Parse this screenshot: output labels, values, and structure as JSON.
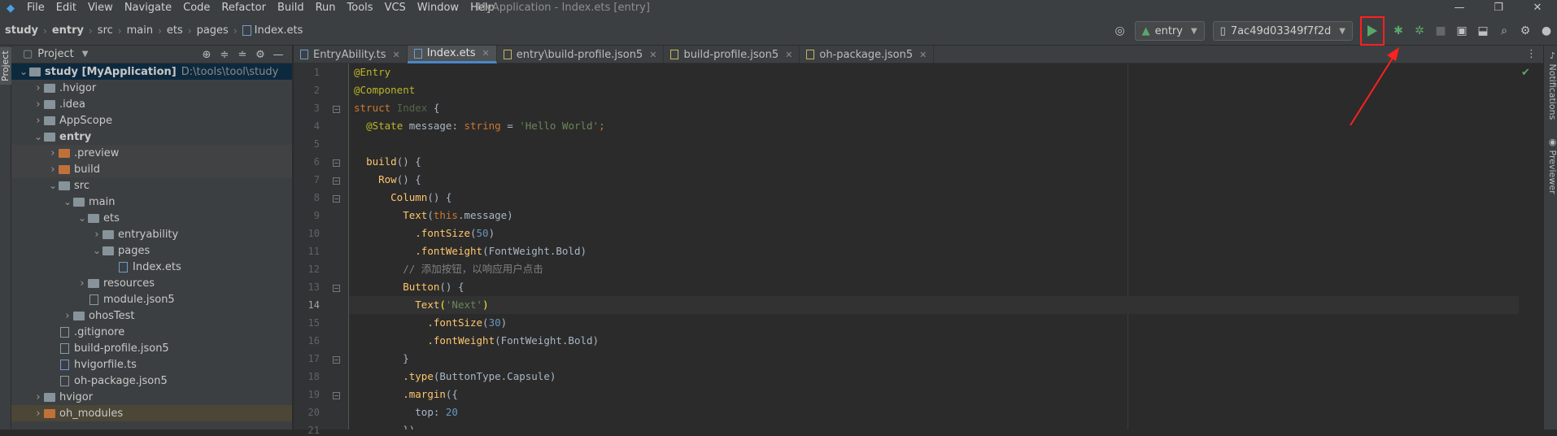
{
  "menubar": {
    "items": [
      "File",
      "Edit",
      "View",
      "Navigate",
      "Code",
      "Refactor",
      "Build",
      "Run",
      "Tools",
      "VCS",
      "Window",
      "Help"
    ],
    "title": "MyApplication - Index.ets [entry]",
    "controls": [
      "—",
      "❐",
      "✕"
    ]
  },
  "breadcrumb": {
    "items": [
      "study",
      "entry",
      "src",
      "main",
      "ets",
      "pages",
      "Index.ets"
    ]
  },
  "toolbar": {
    "module": "entry",
    "device": "7ac49d03349f7f2d"
  },
  "project": {
    "title": "Project",
    "tree": [
      {
        "name": "study [MyApplication]",
        "path": "D:\\tools\\tool\\study",
        "indent": 0,
        "open": true,
        "type": "folder",
        "bold": true
      },
      {
        "name": ".hvigor",
        "indent": 1,
        "type": "folder"
      },
      {
        "name": ".idea",
        "indent": 1,
        "type": "folder"
      },
      {
        "name": "AppScope",
        "indent": 1,
        "type": "folder"
      },
      {
        "name": "entry",
        "indent": 1,
        "open": true,
        "type": "folder",
        "bold": true
      },
      {
        "name": ".preview",
        "indent": 2,
        "type": "folder-orange"
      },
      {
        "name": "build",
        "indent": 2,
        "type": "folder-orange"
      },
      {
        "name": "src",
        "indent": 2,
        "open": true,
        "type": "folder"
      },
      {
        "name": "main",
        "indent": 3,
        "open": true,
        "type": "folder"
      },
      {
        "name": "ets",
        "indent": 4,
        "open": true,
        "type": "folder"
      },
      {
        "name": "entryability",
        "indent": 5,
        "type": "folder"
      },
      {
        "name": "pages",
        "indent": 5,
        "open": true,
        "type": "folder"
      },
      {
        "name": "Index.ets",
        "indent": 6,
        "type": "file-ts",
        "leaf": true
      },
      {
        "name": "resources",
        "indent": 4,
        "type": "folder"
      },
      {
        "name": "module.json5",
        "indent": 4,
        "type": "file",
        "leaf": true
      },
      {
        "name": "ohosTest",
        "indent": 3,
        "type": "folder"
      },
      {
        "name": ".gitignore",
        "indent": 2,
        "type": "file",
        "leaf": true
      },
      {
        "name": "build-profile.json5",
        "indent": 2,
        "type": "file",
        "leaf": true
      },
      {
        "name": "hvigorfile.ts",
        "indent": 2,
        "type": "file-ts",
        "leaf": true
      },
      {
        "name": "oh-package.json5",
        "indent": 2,
        "type": "file",
        "leaf": true
      },
      {
        "name": "hvigor",
        "indent": 1,
        "type": "folder"
      },
      {
        "name": "oh_modules",
        "indent": 1,
        "type": "folder-orange",
        "highlight": true
      }
    ]
  },
  "tabs": [
    {
      "label": "EntryAbility.ts",
      "active": false
    },
    {
      "label": "Index.ets",
      "active": true
    },
    {
      "label": "entry\\build-profile.json5",
      "active": false
    },
    {
      "label": "build-profile.json5",
      "active": false
    },
    {
      "label": "oh-package.json5",
      "active": false
    }
  ],
  "code": [
    [
      [
        "@Entry",
        "#bbb529"
      ]
    ],
    [
      [
        "@Component",
        "#bbb529"
      ]
    ],
    [
      [
        "struct ",
        "#cc7832"
      ],
      [
        "Index ",
        "#6a8759a0"
      ],
      [
        "{",
        "#a9b7c6"
      ]
    ],
    [
      [
        "  ",
        ""
      ],
      [
        "@State ",
        "#bbb529"
      ],
      [
        "message",
        "#a9b7c6"
      ],
      [
        ": ",
        "#a9b7c6"
      ],
      [
        "string ",
        "#cc7832"
      ],
      [
        "= ",
        "#a9b7c6"
      ],
      [
        "'Hello World'",
        "#6a8759"
      ],
      [
        ";",
        "#cc7832"
      ]
    ],
    [],
    [
      [
        "  ",
        ""
      ],
      [
        "build",
        "#ffc66d"
      ],
      [
        "() {",
        "#a9b7c6"
      ]
    ],
    [
      [
        "    ",
        ""
      ],
      [
        "Row",
        "#ffc66d"
      ],
      [
        "() {",
        "#a9b7c6"
      ]
    ],
    [
      [
        "      ",
        ""
      ],
      [
        "Column",
        "#ffc66d"
      ],
      [
        "() {",
        "#a9b7c6"
      ]
    ],
    [
      [
        "        ",
        ""
      ],
      [
        "Text",
        "#ffc66d"
      ],
      [
        "(",
        "#a9b7c6"
      ],
      [
        "this",
        "#cc7832"
      ],
      [
        ".message)",
        "#a9b7c6"
      ]
    ],
    [
      [
        "          ",
        ""
      ],
      [
        ".fontSize",
        "#ffc66d"
      ],
      [
        "(",
        "#a9b7c6"
      ],
      [
        "50",
        "#6897bb"
      ],
      [
        ")",
        "#a9b7c6"
      ]
    ],
    [
      [
        "          ",
        ""
      ],
      [
        ".fontWeight",
        "#ffc66d"
      ],
      [
        "(FontWeight.Bold)",
        "#a9b7c6"
      ]
    ],
    [
      [
        "        ",
        ""
      ],
      [
        "// 添加按钮，以响应用户点击",
        "#808080"
      ]
    ],
    [
      [
        "        ",
        ""
      ],
      [
        "Button",
        "#ffc66d"
      ],
      [
        "() {",
        "#a9b7c6"
      ]
    ],
    [
      [
        "          ",
        ""
      ],
      [
        "Text",
        "#ffc66d"
      ],
      [
        "(",
        "#ffef28"
      ],
      [
        "'Next'",
        "#6a8759"
      ],
      [
        ")",
        "#ffef28"
      ]
    ],
    [
      [
        "            ",
        ""
      ],
      [
        ".fontSize",
        "#ffc66d"
      ],
      [
        "(",
        "#a9b7c6"
      ],
      [
        "30",
        "#6897bb"
      ],
      [
        ")",
        "#a9b7c6"
      ]
    ],
    [
      [
        "            ",
        ""
      ],
      [
        ".fontWeight",
        "#ffc66d"
      ],
      [
        "(FontWeight.Bold)",
        "#a9b7c6"
      ]
    ],
    [
      [
        "        ",
        ""
      ],
      [
        "}",
        "#a9b7c6"
      ]
    ],
    [
      [
        "        ",
        ""
      ],
      [
        ".type",
        "#ffc66d"
      ],
      [
        "(ButtonType.Capsule)",
        "#a9b7c6"
      ]
    ],
    [
      [
        "        ",
        ""
      ],
      [
        ".margin",
        "#ffc66d"
      ],
      [
        "({",
        "#a9b7c6"
      ]
    ],
    [
      [
        "          ",
        ""
      ],
      [
        "top",
        "#a9b7c6"
      ],
      [
        ": ",
        "#a9b7c6"
      ],
      [
        "20",
        "#6897bb"
      ]
    ],
    [
      [
        "        ",
        ""
      ],
      [
        "})",
        "#a9b7c6"
      ]
    ]
  ],
  "rightstrip": {
    "notifications": "Notifications",
    "previewer": "Previewer"
  },
  "leftstrip": {
    "project": "Project"
  }
}
